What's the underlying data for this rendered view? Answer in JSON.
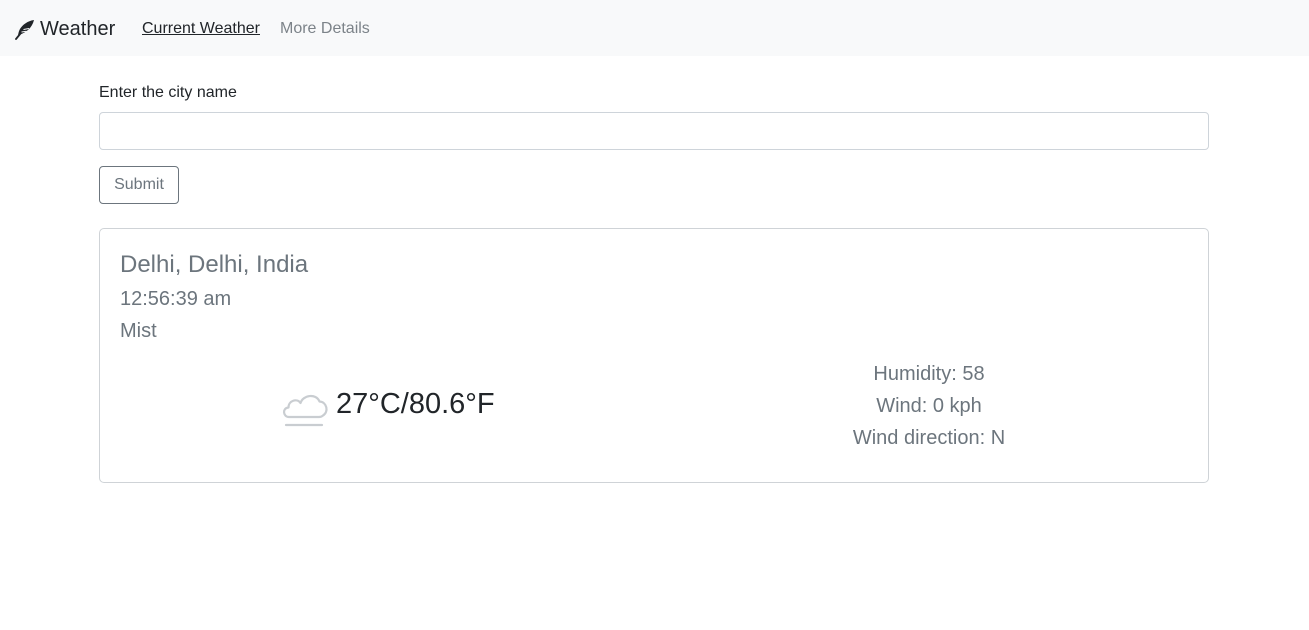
{
  "navbar": {
    "brand_icon": "feather-icon",
    "brand": "Weather",
    "links": [
      {
        "label": "Current Weather",
        "active": true
      },
      {
        "label": "More Details",
        "active": false
      }
    ]
  },
  "form": {
    "label": "Enter the city name",
    "value": "",
    "placeholder": "",
    "submit_label": "Submit"
  },
  "weather": {
    "location": "Delhi, Delhi, India",
    "time": "12:56:39 am",
    "condition": "Mist",
    "condition_icon": "mist-cloud-icon",
    "temperature": "27°C/80.6°F",
    "humidity": "Humidity: 58",
    "wind": "Wind: 0 kph",
    "wind_direction": "Wind direction: N"
  },
  "colors": {
    "navbar_bg": "#f8f9fa",
    "muted_text": "#6c757d",
    "border": "#ced4da"
  }
}
